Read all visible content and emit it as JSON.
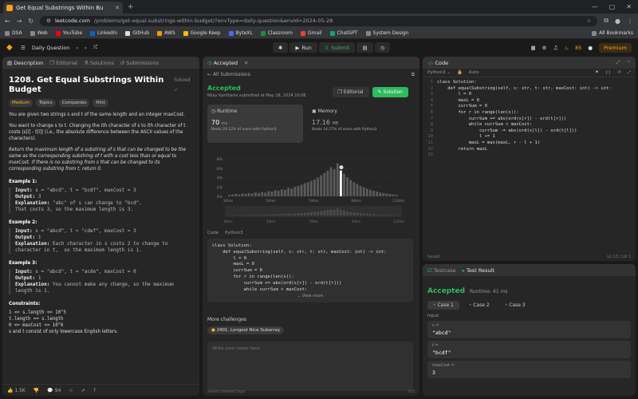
{
  "browser": {
    "tab_title": "Get Equal Substrings Within Bu",
    "url_domain": "leetcode.com",
    "url_path": "/problems/get-equal-substrings-within-budget/?envType=daily-question&envId=2024-05-28",
    "bookmarks": [
      "DSA",
      "Web",
      "YouTube",
      "LinkedIn",
      "GitHub",
      "AWS",
      "Google Keep",
      "ByteXL",
      "Classroom",
      "Gmail",
      "ChatGPT",
      "System Design"
    ],
    "all_bookmarks": "All Bookmarks"
  },
  "nav": {
    "daily": "Daily Question",
    "run": "Run",
    "submit": "Submit",
    "streak": "85",
    "premium": "Premium"
  },
  "left": {
    "tabs": [
      "Description",
      "Editorial",
      "Solutions",
      "Submissions"
    ],
    "title": "1208. Get Equal Substrings Within Budget",
    "solved": "Solved",
    "tags": [
      "Medium",
      "Topics",
      "Companies",
      "Hint"
    ],
    "p1": "You are given two strings s and t of the same length and an integer maxCost.",
    "p2": "You want to change s to t. Changing the ith character of s to ith character of t costs |s[i] - t[i]| (i.e., the absolute difference between the ASCII values of the characters).",
    "p3": "Return the maximum length of a substring of s that can be changed to be the same as the corresponding substring of t with a cost less than or equal to maxCost. If there is no substring from s that can be changed to its corresponding substring from t, return 0.",
    "examples": [
      {
        "h": "Example 1:",
        "input": "s = \"abcd\", t = \"bcdf\", maxCost = 3",
        "output": "3",
        "expl": "\"abc\" of s can change to \"bcd\".\nThat costs 3, so the maximum length is 3."
      },
      {
        "h": "Example 2:",
        "input": "s = \"abcd\", t = \"cdef\", maxCost = 3",
        "output": "1",
        "expl": "Each character in s costs 2 to change to\ncharacter in t,  so the maximum length is 1."
      },
      {
        "h": "Example 3:",
        "input": "s = \"abcd\", t = \"acde\", maxCost = 0",
        "output": "1",
        "expl": "You cannot make any change, so the maximum\nlength is 1."
      }
    ],
    "constraints_h": "Constraints:",
    "constraints": [
      "1 <= s.length <= 10^5",
      "t.length == s.length",
      "0 <= maxCost <= 10^6",
      "s and t consist of only lowercase English letters."
    ],
    "likes": "1.5K",
    "comments": "94"
  },
  "mid": {
    "tab": "Accepted",
    "back": "All Submissions",
    "status": "Accepted",
    "submitted": "Nilay Kantharia submitted at May 28, 2024 10:06",
    "editorial": "Editorial",
    "solution": "Solution",
    "runtime_label": "Runtime",
    "runtime_val": "70",
    "runtime_unit": "ms",
    "runtime_beats": "Beats 29.12% of users with Python3",
    "memory_label": "Memory",
    "memory_val": "17.16",
    "memory_unit": "MB",
    "memory_beats": "Beats 14.27% of users with Python3",
    "code_lang": "Python3",
    "code_h": "Code",
    "code": "class Solution:\n    def equalSubstring(self, s: str, t: str, maxCost: int) -> int:\n        l = 0\n        maxL = 0\n        currSum = 0\n        for r in range(len(s)):\n            currSum += abs(ord(s[r]) - ord(t[r]))\n            while currSum > maxCost:",
    "view_more": "View more",
    "more_challenges": "More challenges",
    "challenge": "2401. Longest Nice Subarray",
    "notes_ph": "Write your notes here",
    "tags_ph": "Select related tags",
    "notes_count": "0/5"
  },
  "chart_data": {
    "type": "bar",
    "ylabel": "",
    "yticks": [
      "8%",
      "6%",
      "4%",
      "2%",
      "0%"
    ],
    "xticks": [
      "34ms",
      "54ms",
      "74ms",
      "94ms",
      "114ms"
    ],
    "values": [
      0.3,
      0.4,
      0.5,
      0.4,
      0.6,
      0.5,
      0.7,
      0.6,
      0.8,
      0.7,
      0.9,
      0.8,
      1.1,
      1.0,
      1.3,
      1.2,
      1.5,
      1.4,
      1.8,
      1.6,
      2.0,
      2.2,
      2.5,
      2.8,
      3.0,
      3.3,
      3.6,
      4.0,
      4.5,
      5.0,
      5.5,
      6.2,
      5.8,
      7.0,
      5.5,
      4.8,
      4.0,
      3.5,
      3.0,
      2.6,
      2.2,
      1.9,
      1.6,
      1.4,
      1.2,
      1.0,
      0.8,
      0.7,
      0.6,
      0.5,
      0.4,
      0.3
    ],
    "highlight_index": 34,
    "ylim": [
      0,
      8
    ]
  },
  "right": {
    "code_tab": "Code",
    "lang": "Python3",
    "auto": "Auto",
    "lines": [
      "class Solution:",
      "    def equalSubstring(self, s: str, t: str, maxCost: int) -> int:",
      "        l = 0",
      "        maxL = 0",
      "        currSum = 0",
      "        for r in range(len(s)):",
      "            currSum += abs(ord(s[r]) - ord(t[r]))",
      "            while currSum > maxCost:",
      "                currSum -= abs(ord(s[l]) - ord(t[l]))",
      "                l += 1",
      "            maxL = max(maxL, r - l + 1)",
      "        return maxL",
      ""
    ],
    "saved": "Saved",
    "cursor": "Ln 13, Col 1",
    "test_tabs": [
      "Testcase",
      "Test Result"
    ],
    "result": "Accepted",
    "runtime": "Runtime: 41 ms",
    "cases": [
      "Case 1",
      "Case 2",
      "Case 3"
    ],
    "input_label": "Input",
    "inputs": [
      {
        "name": "s =",
        "val": "\"abcd\""
      },
      {
        "name": "t =",
        "val": "\"bcdf\""
      },
      {
        "name": "maxCost =",
        "val": "3"
      }
    ]
  },
  "colors": {
    "accent": "#ffa116",
    "green": "#2cbb5d"
  }
}
